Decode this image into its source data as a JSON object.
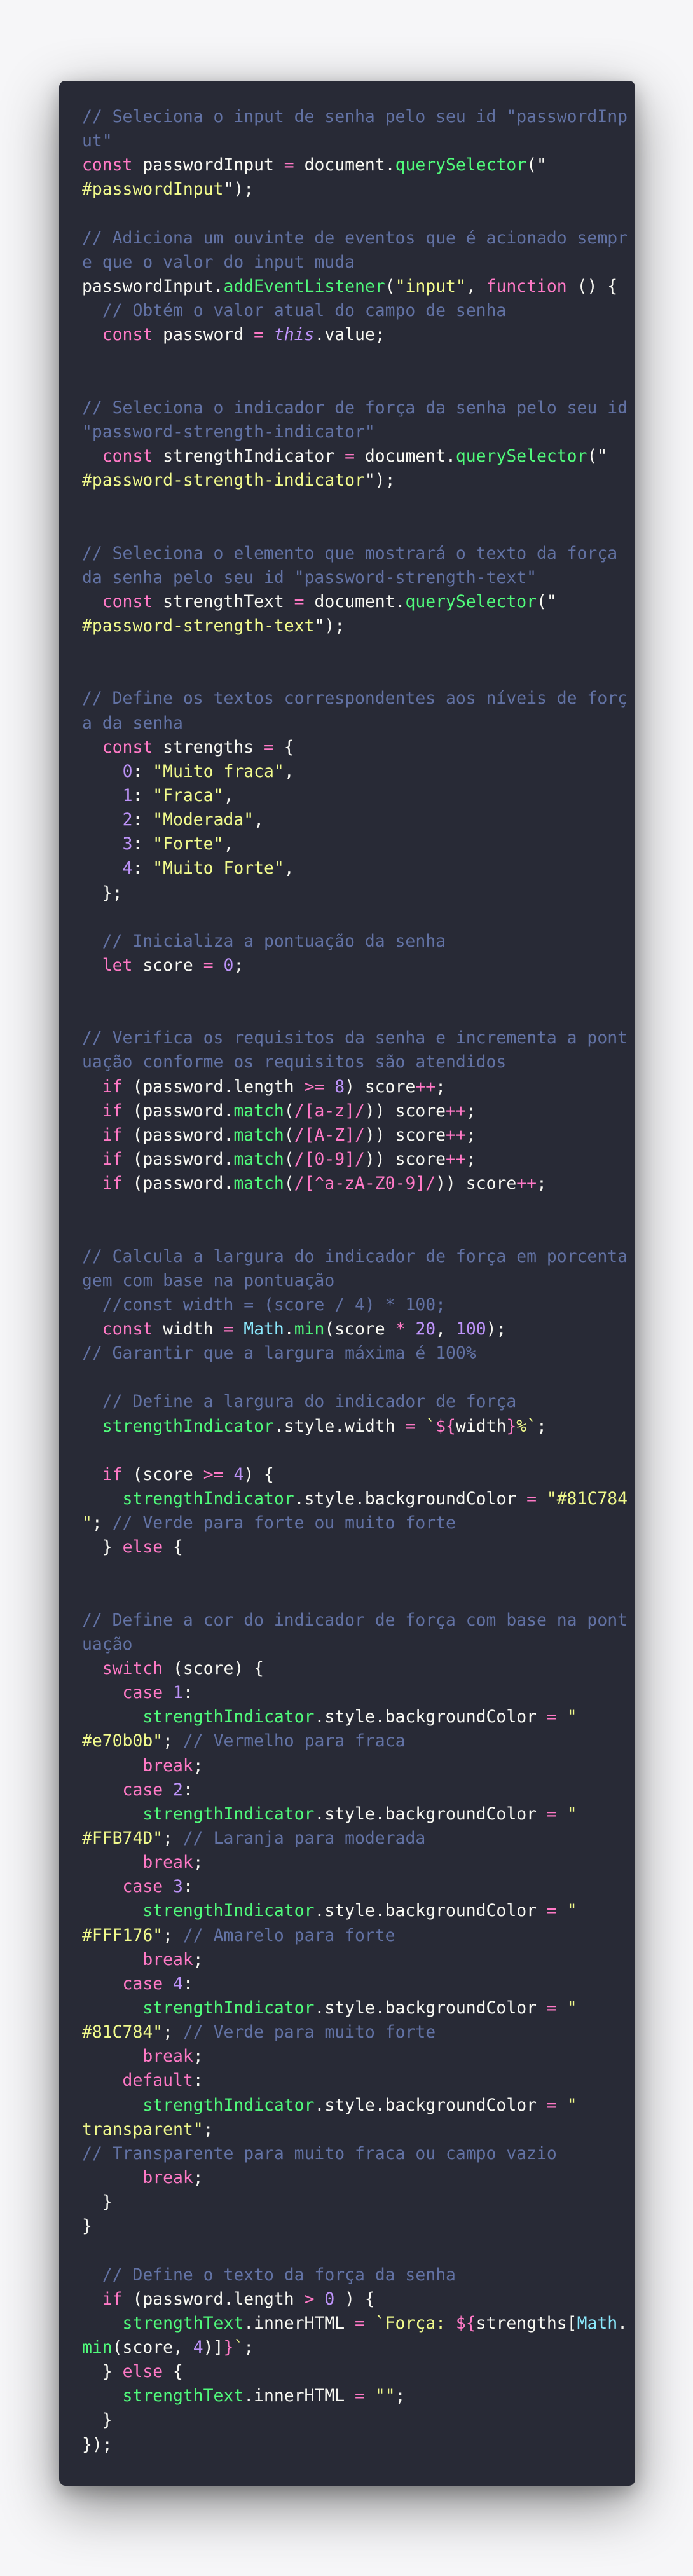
{
  "colors": {
    "page_background": "#f6f6f8",
    "editor_background": "#282a36",
    "text": "#f8f8f2",
    "comment": "#6272a4",
    "keyword": "#ff79c6",
    "function": "#50fa7b",
    "string": "#f1fa8c",
    "number": "#bd93f9",
    "property": "#8be9fd",
    "regex": "#ff79c6"
  },
  "code": {
    "language": "javascript",
    "lines": [
      [
        [
          "comment",
          "// Seleciona o input de senha pelo seu id \"passwordInp"
        ]
      ],
      [
        [
          "comment",
          "ut\""
        ]
      ],
      [
        [
          "keyword",
          "const "
        ],
        [
          "default",
          "passwordInput "
        ],
        [
          "keyword",
          "= "
        ],
        [
          "default",
          "document."
        ],
        [
          "function",
          "querySelector"
        ],
        [
          "default",
          "(\""
        ]
      ],
      [
        [
          "string",
          "#passwordInput"
        ],
        [
          "default",
          "\");"
        ]
      ],
      [],
      [
        [
          "comment",
          "// Adiciona um ouvinte de eventos que é acionado sempr"
        ]
      ],
      [
        [
          "comment",
          "e que o valor do input muda"
        ]
      ],
      [
        [
          "default",
          "passwordInput."
        ],
        [
          "function",
          "addEventListener"
        ],
        [
          "default",
          "("
        ],
        [
          "string",
          "\"input\""
        ],
        [
          "default",
          ", "
        ],
        [
          "keyword",
          "function "
        ],
        [
          "default",
          "() {"
        ]
      ],
      [
        [
          "comment",
          "  // Obtém o valor atual do campo de senha"
        ]
      ],
      [
        [
          "keyword",
          "  const "
        ],
        [
          "default",
          "password "
        ],
        [
          "keyword",
          "= "
        ],
        [
          "this",
          "this"
        ],
        [
          "default",
          ".value;"
        ]
      ],
      [],
      [],
      [
        [
          "comment",
          "// Seleciona o indicador de força da senha pelo seu id"
        ]
      ],
      [
        [
          "comment",
          "\"password-strength-indicator\""
        ]
      ],
      [
        [
          "keyword",
          "  const "
        ],
        [
          "default",
          "strengthIndicator "
        ],
        [
          "keyword",
          "= "
        ],
        [
          "default",
          "document."
        ],
        [
          "function",
          "querySelector"
        ],
        [
          "default",
          "(\""
        ]
      ],
      [
        [
          "string",
          "#password-strength-indicator"
        ],
        [
          "default",
          "\");"
        ]
      ],
      [],
      [],
      [
        [
          "comment",
          "// Seleciona o elemento que mostrará o texto da força"
        ]
      ],
      [
        [
          "comment",
          "da senha pelo seu id \"password-strength-text\""
        ]
      ],
      [
        [
          "keyword",
          "  const "
        ],
        [
          "default",
          "strengthText "
        ],
        [
          "keyword",
          "= "
        ],
        [
          "default",
          "document."
        ],
        [
          "function",
          "querySelector"
        ],
        [
          "default",
          "(\""
        ]
      ],
      [
        [
          "string",
          "#password-strength-text"
        ],
        [
          "default",
          "\");"
        ]
      ],
      [],
      [],
      [
        [
          "comment",
          "// Define os textos correspondentes aos níveis de forç"
        ]
      ],
      [
        [
          "comment",
          "a da senha"
        ]
      ],
      [
        [
          "keyword",
          "  const "
        ],
        [
          "default",
          "strengths "
        ],
        [
          "keyword",
          "= "
        ],
        [
          "default",
          "{"
        ]
      ],
      [
        [
          "default",
          "    "
        ],
        [
          "number",
          "0"
        ],
        [
          "default",
          ": "
        ],
        [
          "string",
          "\"Muito fraca\""
        ],
        [
          "default",
          ","
        ]
      ],
      [
        [
          "default",
          "    "
        ],
        [
          "number",
          "1"
        ],
        [
          "default",
          ": "
        ],
        [
          "string",
          "\"Fraca\""
        ],
        [
          "default",
          ","
        ]
      ],
      [
        [
          "default",
          "    "
        ],
        [
          "number",
          "2"
        ],
        [
          "default",
          ": "
        ],
        [
          "string",
          "\"Moderada\""
        ],
        [
          "default",
          ","
        ]
      ],
      [
        [
          "default",
          "    "
        ],
        [
          "number",
          "3"
        ],
        [
          "default",
          ": "
        ],
        [
          "string",
          "\"Forte\""
        ],
        [
          "default",
          ","
        ]
      ],
      [
        [
          "default",
          "    "
        ],
        [
          "number",
          "4"
        ],
        [
          "default",
          ": "
        ],
        [
          "string",
          "\"Muito Forte\""
        ],
        [
          "default",
          ","
        ]
      ],
      [
        [
          "default",
          "  };"
        ]
      ],
      [],
      [
        [
          "comment",
          "  // Inicializa a pontuação da senha"
        ]
      ],
      [
        [
          "keyword",
          "  let "
        ],
        [
          "default",
          "score "
        ],
        [
          "keyword",
          "= "
        ],
        [
          "number",
          "0"
        ],
        [
          "default",
          ";"
        ]
      ],
      [],
      [],
      [
        [
          "comment",
          "// Verifica os requisitos da senha e incrementa a pont"
        ]
      ],
      [
        [
          "comment",
          "uação conforme os requisitos são atendidos"
        ]
      ],
      [
        [
          "keyword",
          "  if "
        ],
        [
          "default",
          "(password.length "
        ],
        [
          "keyword",
          ">= "
        ],
        [
          "number",
          "8"
        ],
        [
          "default",
          ") score"
        ],
        [
          "keyword",
          "++"
        ],
        [
          "default",
          ";"
        ]
      ],
      [
        [
          "keyword",
          "  if "
        ],
        [
          "default",
          "(password."
        ],
        [
          "function",
          "match"
        ],
        [
          "default",
          "("
        ],
        [
          "regex",
          "/[a-z]/"
        ],
        [
          "default",
          ")) score"
        ],
        [
          "keyword",
          "++"
        ],
        [
          "default",
          ";"
        ]
      ],
      [
        [
          "keyword",
          "  if "
        ],
        [
          "default",
          "(password."
        ],
        [
          "function",
          "match"
        ],
        [
          "default",
          "("
        ],
        [
          "regex",
          "/[A-Z]/"
        ],
        [
          "default",
          ")) score"
        ],
        [
          "keyword",
          "++"
        ],
        [
          "default",
          ";"
        ]
      ],
      [
        [
          "keyword",
          "  if "
        ],
        [
          "default",
          "(password."
        ],
        [
          "function",
          "match"
        ],
        [
          "default",
          "("
        ],
        [
          "regex",
          "/[0-9]/"
        ],
        [
          "default",
          ")) score"
        ],
        [
          "keyword",
          "++"
        ],
        [
          "default",
          ";"
        ]
      ],
      [
        [
          "keyword",
          "  if "
        ],
        [
          "default",
          "(password."
        ],
        [
          "function",
          "match"
        ],
        [
          "default",
          "("
        ],
        [
          "regex",
          "/[^a-zA-Z0-9]/"
        ],
        [
          "default",
          ")) score"
        ],
        [
          "keyword",
          "++"
        ],
        [
          "default",
          ";"
        ]
      ],
      [],
      [],
      [
        [
          "comment",
          "// Calcula a largura do indicador de força em porcenta"
        ]
      ],
      [
        [
          "comment",
          "gem com base na pontuação"
        ]
      ],
      [
        [
          "comment",
          "  //const width = (score / 4) * 100;"
        ]
      ],
      [
        [
          "keyword",
          "  const "
        ],
        [
          "default",
          "width "
        ],
        [
          "keyword",
          "= "
        ],
        [
          "property",
          "Math"
        ],
        [
          "default",
          "."
        ],
        [
          "function",
          "min"
        ],
        [
          "default",
          "(score "
        ],
        [
          "keyword",
          "* "
        ],
        [
          "number",
          "20"
        ],
        [
          "default",
          ", "
        ],
        [
          "number",
          "100"
        ],
        [
          "default",
          ");"
        ]
      ],
      [
        [
          "comment",
          "// Garantir que a largura máxima é 100%"
        ]
      ],
      [],
      [
        [
          "comment",
          "  // Define a largura do indicador de força"
        ]
      ],
      [
        [
          "function",
          "  strengthIndicator"
        ],
        [
          "default",
          ".style.width "
        ],
        [
          "keyword",
          "= "
        ],
        [
          "string",
          "`"
        ],
        [
          "keyword",
          "${"
        ],
        [
          "default",
          "width"
        ],
        [
          "keyword",
          "}"
        ],
        [
          "string",
          "%`"
        ],
        [
          "default",
          ";"
        ]
      ],
      [],
      [
        [
          "keyword",
          "  if "
        ],
        [
          "default",
          "(score "
        ],
        [
          "keyword",
          ">= "
        ],
        [
          "number",
          "4"
        ],
        [
          "default",
          ") {"
        ]
      ],
      [
        [
          "function",
          "    strengthIndicator"
        ],
        [
          "default",
          ".style.backgroundColor "
        ],
        [
          "keyword",
          "= "
        ],
        [
          "string",
          "\"#81C784"
        ]
      ],
      [
        [
          "string",
          "\""
        ],
        [
          "default",
          "; "
        ],
        [
          "comment",
          "// Verde para forte ou muito forte"
        ]
      ],
      [
        [
          "default",
          "  } "
        ],
        [
          "keyword",
          "else "
        ],
        [
          "default",
          "{"
        ]
      ],
      [],
      [],
      [
        [
          "comment",
          "// Define a cor do indicador de força com base na pont"
        ]
      ],
      [
        [
          "comment",
          "uação"
        ]
      ],
      [
        [
          "keyword",
          "  switch "
        ],
        [
          "default",
          "(score) {"
        ]
      ],
      [
        [
          "keyword",
          "    case "
        ],
        [
          "number",
          "1"
        ],
        [
          "default",
          ":"
        ]
      ],
      [
        [
          "function",
          "      strengthIndicator"
        ],
        [
          "default",
          ".style.backgroundColor "
        ],
        [
          "keyword",
          "= "
        ],
        [
          "string",
          "\""
        ]
      ],
      [
        [
          "string",
          "#e70b0b"
        ],
        [
          "string",
          "\""
        ],
        [
          "default",
          "; "
        ],
        [
          "comment",
          "// Vermelho para fraca"
        ]
      ],
      [
        [
          "keyword",
          "      break"
        ],
        [
          "default",
          ";"
        ]
      ],
      [
        [
          "keyword",
          "    case "
        ],
        [
          "number",
          "2"
        ],
        [
          "default",
          ":"
        ]
      ],
      [
        [
          "function",
          "      strengthIndicator"
        ],
        [
          "default",
          ".style.backgroundColor "
        ],
        [
          "keyword",
          "= "
        ],
        [
          "string",
          "\""
        ]
      ],
      [
        [
          "string",
          "#FFB74D"
        ],
        [
          "string",
          "\""
        ],
        [
          "default",
          "; "
        ],
        [
          "comment",
          "// Laranja para moderada"
        ]
      ],
      [
        [
          "keyword",
          "      break"
        ],
        [
          "default",
          ";"
        ]
      ],
      [
        [
          "keyword",
          "    case "
        ],
        [
          "number",
          "3"
        ],
        [
          "default",
          ":"
        ]
      ],
      [
        [
          "function",
          "      strengthIndicator"
        ],
        [
          "default",
          ".style.backgroundColor "
        ],
        [
          "keyword",
          "= "
        ],
        [
          "string",
          "\""
        ]
      ],
      [
        [
          "string",
          "#FFF176"
        ],
        [
          "string",
          "\""
        ],
        [
          "default",
          "; "
        ],
        [
          "comment",
          "// Amarelo para forte"
        ]
      ],
      [
        [
          "keyword",
          "      break"
        ],
        [
          "default",
          ";"
        ]
      ],
      [
        [
          "keyword",
          "    case "
        ],
        [
          "number",
          "4"
        ],
        [
          "default",
          ":"
        ]
      ],
      [
        [
          "function",
          "      strengthIndicator"
        ],
        [
          "default",
          ".style.backgroundColor "
        ],
        [
          "keyword",
          "= "
        ],
        [
          "string",
          "\""
        ]
      ],
      [
        [
          "string",
          "#81C784"
        ],
        [
          "string",
          "\""
        ],
        [
          "default",
          "; "
        ],
        [
          "comment",
          "// Verde para muito forte"
        ]
      ],
      [
        [
          "keyword",
          "      break"
        ],
        [
          "default",
          ";"
        ]
      ],
      [
        [
          "keyword",
          "    default"
        ],
        [
          "default",
          ":"
        ]
      ],
      [
        [
          "function",
          "      strengthIndicator"
        ],
        [
          "default",
          ".style.backgroundColor "
        ],
        [
          "keyword",
          "= "
        ],
        [
          "string",
          "\""
        ]
      ],
      [
        [
          "string",
          "transparent"
        ],
        [
          "string",
          "\""
        ],
        [
          "default",
          ";"
        ]
      ],
      [
        [
          "comment",
          "// Transparente para muito fraca ou campo vazio"
        ]
      ],
      [
        [
          "keyword",
          "      break"
        ],
        [
          "default",
          ";"
        ]
      ],
      [
        [
          "default",
          "  }"
        ]
      ],
      [
        [
          "default",
          "}"
        ]
      ],
      [],
      [
        [
          "comment",
          "  // Define o texto da força da senha"
        ]
      ],
      [
        [
          "keyword",
          "  if "
        ],
        [
          "default",
          "(password.length "
        ],
        [
          "keyword",
          "> "
        ],
        [
          "number",
          "0 "
        ],
        [
          "default",
          ") {"
        ]
      ],
      [
        [
          "function",
          "    strengthText"
        ],
        [
          "default",
          ".innerHTML "
        ],
        [
          "keyword",
          "= "
        ],
        [
          "string",
          "`Força: "
        ],
        [
          "keyword",
          "${"
        ],
        [
          "default",
          "strengths["
        ],
        [
          "property",
          "Math"
        ],
        [
          "default",
          "."
        ]
      ],
      [
        [
          "function",
          "min"
        ],
        [
          "default",
          "(score, "
        ],
        [
          "number",
          "4"
        ],
        [
          "default",
          ")]"
        ],
        [
          "keyword",
          "}"
        ],
        [
          "string",
          "`"
        ],
        [
          "default",
          ";"
        ]
      ],
      [
        [
          "default",
          "  } "
        ],
        [
          "keyword",
          "else "
        ],
        [
          "default",
          "{"
        ]
      ],
      [
        [
          "function",
          "    strengthText"
        ],
        [
          "default",
          ".innerHTML "
        ],
        [
          "keyword",
          "= "
        ],
        [
          "string",
          "\"\""
        ],
        [
          "default",
          ";"
        ]
      ],
      [
        [
          "default",
          "  }"
        ]
      ],
      [
        [
          "default",
          "});"
        ]
      ]
    ]
  }
}
